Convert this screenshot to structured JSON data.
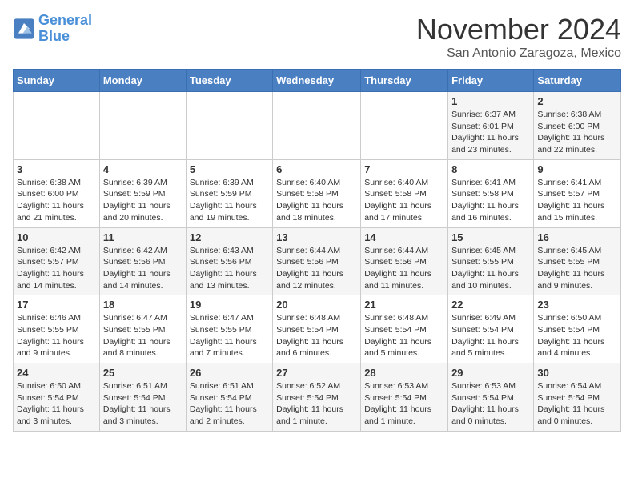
{
  "logo": {
    "line1": "General",
    "line2": "Blue"
  },
  "title": "November 2024",
  "location": "San Antonio Zaragoza, Mexico",
  "days_of_week": [
    "Sunday",
    "Monday",
    "Tuesday",
    "Wednesday",
    "Thursday",
    "Friday",
    "Saturday"
  ],
  "weeks": [
    [
      {
        "day": "",
        "info": ""
      },
      {
        "day": "",
        "info": ""
      },
      {
        "day": "",
        "info": ""
      },
      {
        "day": "",
        "info": ""
      },
      {
        "day": "",
        "info": ""
      },
      {
        "day": "1",
        "info": "Sunrise: 6:37 AM\nSunset: 6:01 PM\nDaylight: 11 hours and 23 minutes."
      },
      {
        "day": "2",
        "info": "Sunrise: 6:38 AM\nSunset: 6:00 PM\nDaylight: 11 hours and 22 minutes."
      }
    ],
    [
      {
        "day": "3",
        "info": "Sunrise: 6:38 AM\nSunset: 6:00 PM\nDaylight: 11 hours and 21 minutes."
      },
      {
        "day": "4",
        "info": "Sunrise: 6:39 AM\nSunset: 5:59 PM\nDaylight: 11 hours and 20 minutes."
      },
      {
        "day": "5",
        "info": "Sunrise: 6:39 AM\nSunset: 5:59 PM\nDaylight: 11 hours and 19 minutes."
      },
      {
        "day": "6",
        "info": "Sunrise: 6:40 AM\nSunset: 5:58 PM\nDaylight: 11 hours and 18 minutes."
      },
      {
        "day": "7",
        "info": "Sunrise: 6:40 AM\nSunset: 5:58 PM\nDaylight: 11 hours and 17 minutes."
      },
      {
        "day": "8",
        "info": "Sunrise: 6:41 AM\nSunset: 5:58 PM\nDaylight: 11 hours and 16 minutes."
      },
      {
        "day": "9",
        "info": "Sunrise: 6:41 AM\nSunset: 5:57 PM\nDaylight: 11 hours and 15 minutes."
      }
    ],
    [
      {
        "day": "10",
        "info": "Sunrise: 6:42 AM\nSunset: 5:57 PM\nDaylight: 11 hours and 14 minutes."
      },
      {
        "day": "11",
        "info": "Sunrise: 6:42 AM\nSunset: 5:56 PM\nDaylight: 11 hours and 14 minutes."
      },
      {
        "day": "12",
        "info": "Sunrise: 6:43 AM\nSunset: 5:56 PM\nDaylight: 11 hours and 13 minutes."
      },
      {
        "day": "13",
        "info": "Sunrise: 6:44 AM\nSunset: 5:56 PM\nDaylight: 11 hours and 12 minutes."
      },
      {
        "day": "14",
        "info": "Sunrise: 6:44 AM\nSunset: 5:56 PM\nDaylight: 11 hours and 11 minutes."
      },
      {
        "day": "15",
        "info": "Sunrise: 6:45 AM\nSunset: 5:55 PM\nDaylight: 11 hours and 10 minutes."
      },
      {
        "day": "16",
        "info": "Sunrise: 6:45 AM\nSunset: 5:55 PM\nDaylight: 11 hours and 9 minutes."
      }
    ],
    [
      {
        "day": "17",
        "info": "Sunrise: 6:46 AM\nSunset: 5:55 PM\nDaylight: 11 hours and 9 minutes."
      },
      {
        "day": "18",
        "info": "Sunrise: 6:47 AM\nSunset: 5:55 PM\nDaylight: 11 hours and 8 minutes."
      },
      {
        "day": "19",
        "info": "Sunrise: 6:47 AM\nSunset: 5:55 PM\nDaylight: 11 hours and 7 minutes."
      },
      {
        "day": "20",
        "info": "Sunrise: 6:48 AM\nSunset: 5:54 PM\nDaylight: 11 hours and 6 minutes."
      },
      {
        "day": "21",
        "info": "Sunrise: 6:48 AM\nSunset: 5:54 PM\nDaylight: 11 hours and 5 minutes."
      },
      {
        "day": "22",
        "info": "Sunrise: 6:49 AM\nSunset: 5:54 PM\nDaylight: 11 hours and 5 minutes."
      },
      {
        "day": "23",
        "info": "Sunrise: 6:50 AM\nSunset: 5:54 PM\nDaylight: 11 hours and 4 minutes."
      }
    ],
    [
      {
        "day": "24",
        "info": "Sunrise: 6:50 AM\nSunset: 5:54 PM\nDaylight: 11 hours and 3 minutes."
      },
      {
        "day": "25",
        "info": "Sunrise: 6:51 AM\nSunset: 5:54 PM\nDaylight: 11 hours and 3 minutes."
      },
      {
        "day": "26",
        "info": "Sunrise: 6:51 AM\nSunset: 5:54 PM\nDaylight: 11 hours and 2 minutes."
      },
      {
        "day": "27",
        "info": "Sunrise: 6:52 AM\nSunset: 5:54 PM\nDaylight: 11 hours and 1 minute."
      },
      {
        "day": "28",
        "info": "Sunrise: 6:53 AM\nSunset: 5:54 PM\nDaylight: 11 hours and 1 minute."
      },
      {
        "day": "29",
        "info": "Sunrise: 6:53 AM\nSunset: 5:54 PM\nDaylight: 11 hours and 0 minutes."
      },
      {
        "day": "30",
        "info": "Sunrise: 6:54 AM\nSunset: 5:54 PM\nDaylight: 11 hours and 0 minutes."
      }
    ]
  ]
}
